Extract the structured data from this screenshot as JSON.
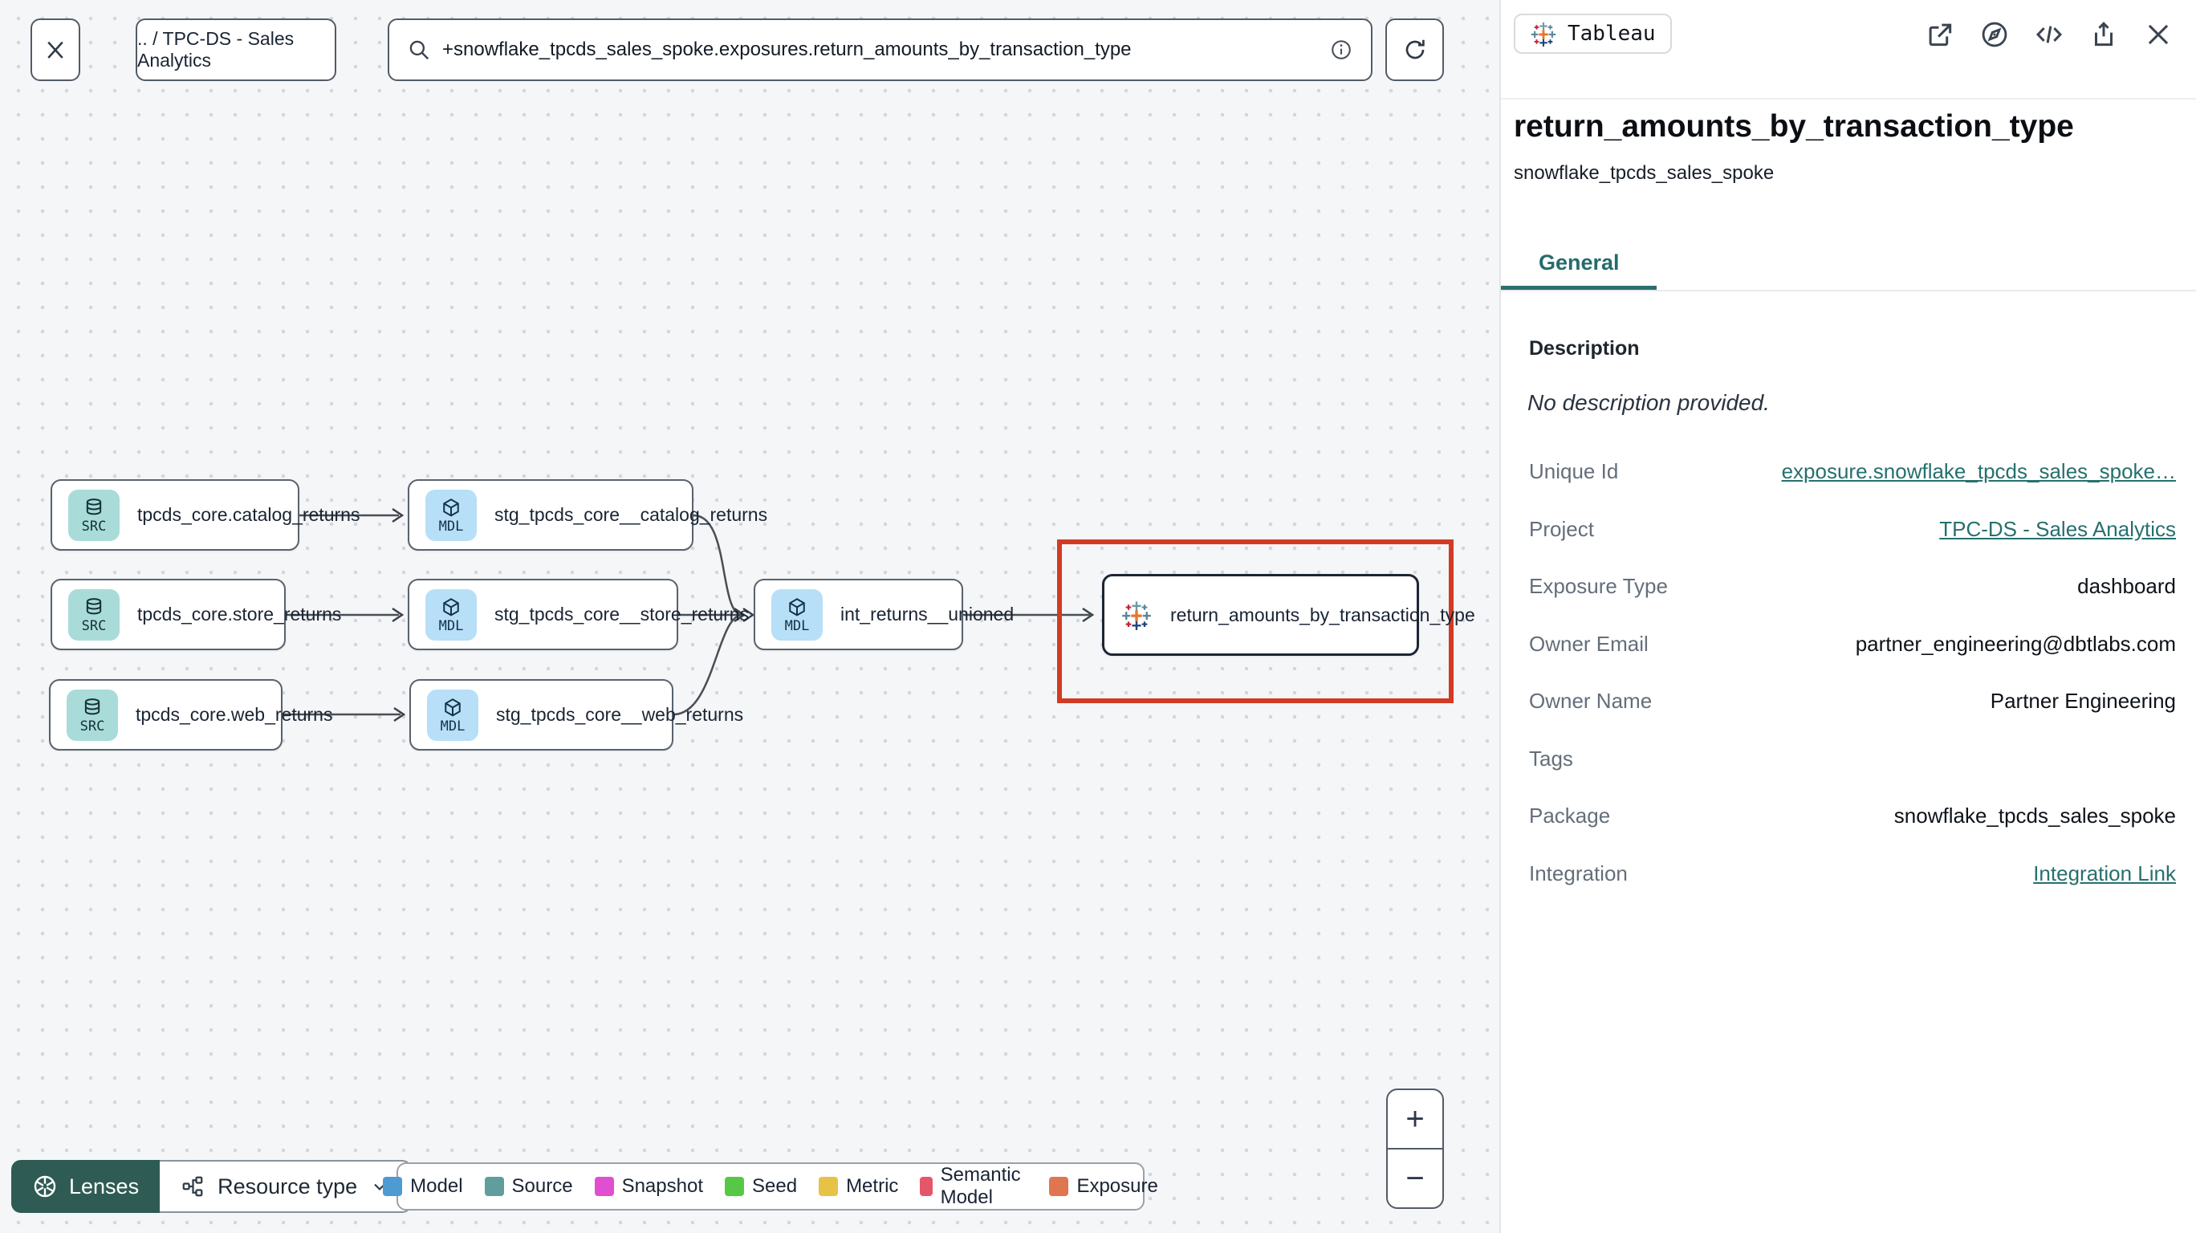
{
  "topbar": {
    "breadcrumb": ".. / TPC-DS - Sales Analytics",
    "search_value": "+snowflake_tpcds_sales_spoke.exposures.return_amounts_by_transaction_type"
  },
  "graph": {
    "nodes": [
      {
        "label": "tpcds_core.catalog_returns",
        "type": "source",
        "badge": "SRC"
      },
      {
        "label": "tpcds_core.store_returns",
        "type": "source",
        "badge": "SRC"
      },
      {
        "label": "tpcds_core.web_returns",
        "type": "source",
        "badge": "SRC"
      },
      {
        "label": "stg_tpcds_core__catalog_returns",
        "type": "model",
        "badge": "MDL"
      },
      {
        "label": "stg_tpcds_core__store_returns",
        "type": "model",
        "badge": "MDL"
      },
      {
        "label": "stg_tpcds_core__web_returns",
        "type": "model",
        "badge": "MDL"
      },
      {
        "label": "int_returns__unioned",
        "type": "model",
        "badge": "MDL"
      },
      {
        "label": "return_amounts_by_transaction_type",
        "type": "exposure"
      }
    ],
    "highlight_color": "#d23b23"
  },
  "controls": {
    "lenses_label": "Lenses",
    "resource_type_label": "Resource type",
    "zoom_in": "+",
    "zoom_out": "−"
  },
  "legend": {
    "items": [
      {
        "label": "Model",
        "color": "#4e9ad2"
      },
      {
        "label": "Source",
        "color": "#5f9e9c"
      },
      {
        "label": "Snapshot",
        "color": "#df4fd0"
      },
      {
        "label": "Seed",
        "color": "#57c846"
      },
      {
        "label": "Metric",
        "color": "#e6c345"
      },
      {
        "label": "Semantic Model",
        "color": "#e6566b"
      },
      {
        "label": "Exposure",
        "color": "#df7650"
      }
    ]
  },
  "panel": {
    "integration_badge": "Tableau",
    "title": "return_amounts_by_transaction_type",
    "subtitle": "snowflake_tpcds_sales_spoke",
    "tab_label": "General",
    "description_label": "Description",
    "description_value": "No description provided.",
    "rows": [
      {
        "label": "Unique Id",
        "value": "exposure.snowflake_tpcds_sales_spoke…",
        "link": true
      },
      {
        "label": "Project",
        "value": "TPC-DS - Sales Analytics",
        "link": true
      },
      {
        "label": "Exposure Type",
        "value": "dashboard",
        "link": false
      },
      {
        "label": "Owner Email",
        "value": "partner_engineering@dbtlabs.com",
        "link": false
      },
      {
        "label": "Owner Name",
        "value": "Partner Engineering",
        "link": false
      },
      {
        "label": "Tags",
        "value": "",
        "link": false
      },
      {
        "label": "Package",
        "value": "snowflake_tpcds_sales_spoke",
        "link": false
      },
      {
        "label": "Integration",
        "value": "Integration Link",
        "link": true
      }
    ]
  }
}
